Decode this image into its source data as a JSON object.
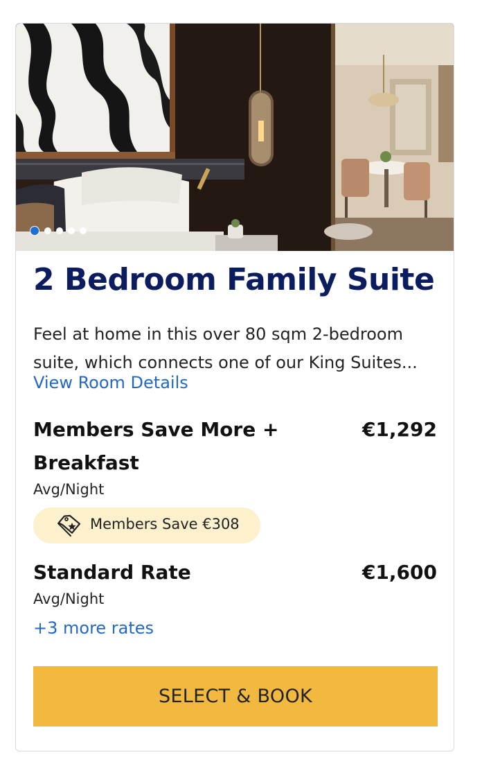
{
  "room": {
    "title": "2 Bedroom Family Suite",
    "description_line1": "Feel at home in this over 80 sqm 2-bedroom",
    "description_line2": "suite, which connects one of our King Suites...",
    "view_details_label": "View Room Details"
  },
  "carousel": {
    "total_images": 5,
    "active_index": 0,
    "image_description": "hotel suite bedroom with marble wall, pendant lamp and dining area"
  },
  "rates": [
    {
      "name_line1": "Members Save More +",
      "name_line2": "Breakfast",
      "price": "€1,292",
      "per": "Avg/Night",
      "badge": "Members Save €308"
    },
    {
      "name_line1": "Standard Rate",
      "price": "€1,600",
      "per": "Avg/Night"
    }
  ],
  "more_rates_label": "+3 more rates",
  "cta_label": "SELECT & BOOK",
  "colors": {
    "title": "#0b1d5f",
    "link": "#2268c4",
    "badge_bg": "#fcf0cd",
    "cta_bg": "#f2b941",
    "carousel_active": "#1f6fd1"
  },
  "icons": {
    "badge": "price-tag-star-icon"
  }
}
